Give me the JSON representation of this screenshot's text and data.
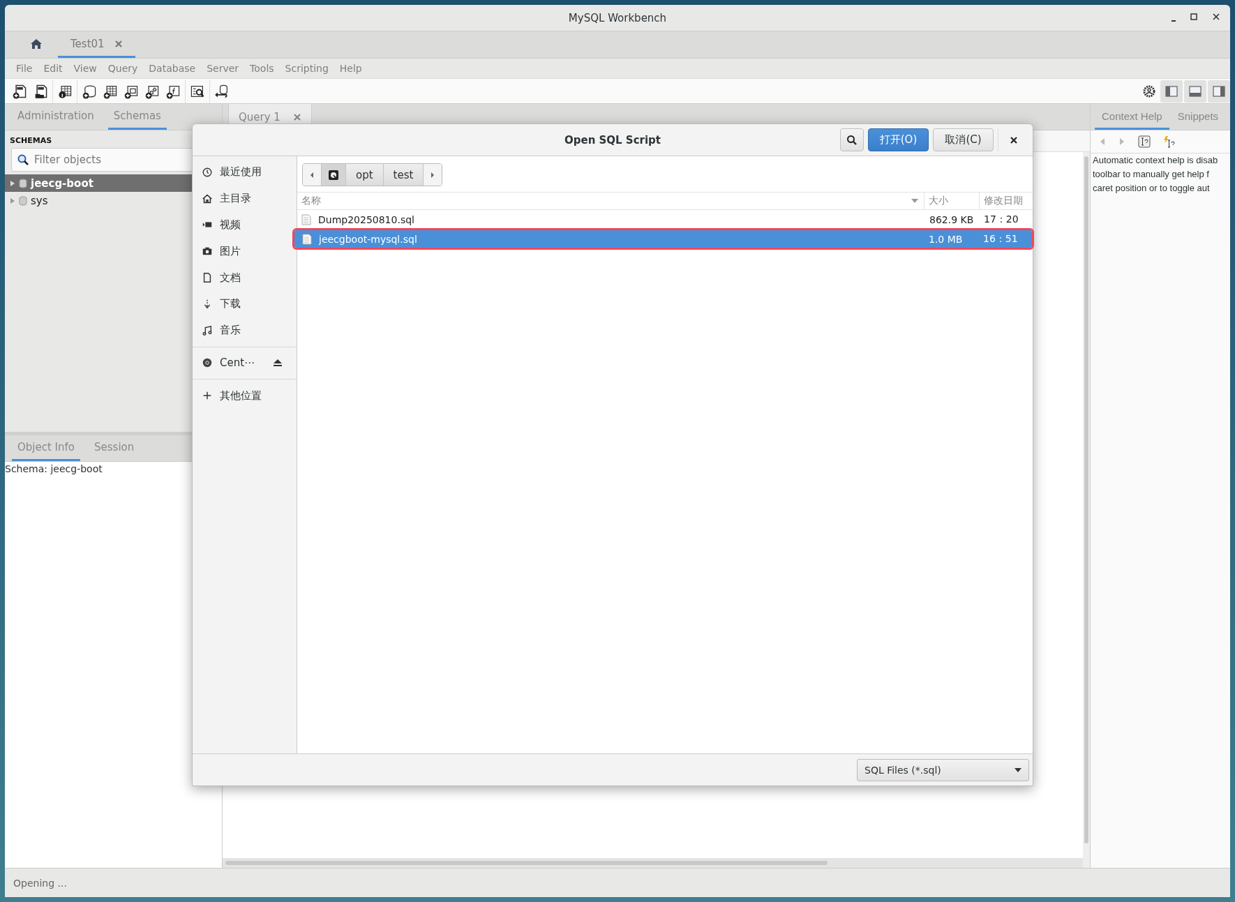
{
  "window": {
    "title": "MySQL Workbench"
  },
  "connection_tabs": [
    {
      "kind": "home",
      "selected": false
    },
    {
      "kind": "connection",
      "label": "Test01",
      "selected": true
    }
  ],
  "menu": [
    "File",
    "Edit",
    "View",
    "Query",
    "Database",
    "Server",
    "Tools",
    "Scripting",
    "Help"
  ],
  "sidebar": {
    "tabs": [
      {
        "label": "Administration",
        "selected": false
      },
      {
        "label": "Schemas",
        "selected": true
      }
    ],
    "heading": "SCHEMAS",
    "filter": {
      "placeholder": "Filter objects"
    },
    "schemas": [
      {
        "name": "jeecg-boot",
        "selected": true,
        "expanded": false
      },
      {
        "name": "sys",
        "selected": false,
        "expanded": false
      }
    ]
  },
  "info_panel": {
    "tabs": [
      {
        "label": "Object Info",
        "selected": true
      },
      {
        "label": "Session",
        "selected": false
      }
    ],
    "text": "Schema: jeecg-boot"
  },
  "editor": {
    "tabs": [
      {
        "label": "Query 1",
        "selected": true
      }
    ]
  },
  "context_panel": {
    "tabs": [
      {
        "label": "Context Help",
        "selected": true
      },
      {
        "label": "Snippets",
        "selected": false
      }
    ],
    "lines": [
      "Automatic context help is disab",
      "toolbar to manually get help f",
      "caret position or to toggle aut"
    ]
  },
  "dialog": {
    "title": "Open SQL Script",
    "buttons": [
      {
        "kind": "search"
      },
      {
        "kind": "primary",
        "label": "打开(O)"
      },
      {
        "kind": "secondary",
        "label": "取消(C)"
      },
      {
        "kind": "close"
      }
    ],
    "place_groups": [
      [
        {
          "kind": "recent",
          "label": "最近使用"
        },
        {
          "kind": "home",
          "label": "主目录"
        },
        {
          "kind": "video",
          "label": "视频"
        },
        {
          "kind": "camera",
          "label": "图片"
        },
        {
          "kind": "document",
          "label": "文档"
        },
        {
          "kind": "download",
          "label": "下载"
        },
        {
          "kind": "music",
          "label": "音乐"
        }
      ],
      [
        {
          "kind": "disc",
          "label": "Cent⋯"
        }
      ],
      [
        {
          "kind": "other",
          "label": "其他位置"
        }
      ]
    ],
    "path": [
      "opt",
      "test"
    ],
    "columns": [
      "名称",
      "大小",
      "修改日期"
    ],
    "files": [
      {
        "name": "Dump20250810.sql",
        "size": "862.9 KB",
        "modified": "17：20",
        "selected": false,
        "highlighted": false
      },
      {
        "name": "jeecgboot-mysql.sql",
        "size": "1.0 MB",
        "modified": "16：51",
        "selected": true,
        "highlighted": true
      }
    ],
    "filter": "SQL Files (*.sql)"
  },
  "status_bar": "Opening ..."
}
